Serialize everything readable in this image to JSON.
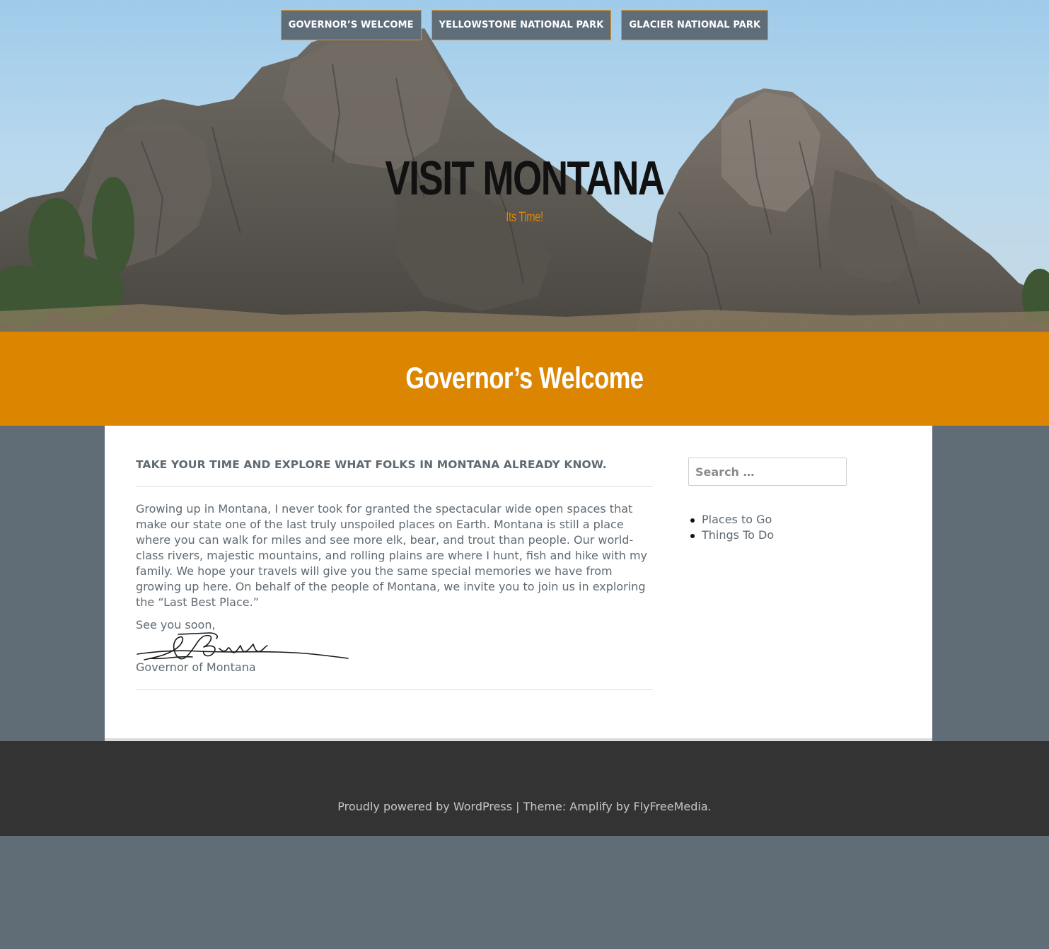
{
  "nav": {
    "items": [
      {
        "label": "GOVERNOR’S WELCOME"
      },
      {
        "label": "YELLOWSTONE NATIONAL PARK"
      },
      {
        "label": "GLACIER NATIONAL PARK"
      }
    ]
  },
  "site": {
    "title": "VISIT MONTANA",
    "tagline": "Its Time!"
  },
  "page": {
    "title": "Governor’s Welcome"
  },
  "entry": {
    "heading": "TAKE YOUR TIME AND EXPLORE WHAT FOLKS IN MONTANA ALREADY KNOW.",
    "body": "Growing up in Montana, I never took for granted the spectacular wide open spaces that make our state one of the last truly unspoiled places on Earth. Montana is still a place where you can walk for miles and see more elk, bear, and trout than people. Our world-class rivers, majestic mountains, and rolling plains are where I hunt, fish and hike with my family. We hope your travels will give you the same special memories we have from growing up here. On behalf of the people of Montana, we invite you to join us in exploring the “Last Best Place.”",
    "closing": "See you soon,",
    "sign_title": "Governor of Montana"
  },
  "sidebar": {
    "search_placeholder": "Search …",
    "links": [
      {
        "label": "Places to Go"
      },
      {
        "label": "Things To Do"
      }
    ]
  },
  "footer": {
    "powered_prefix": "Proudly powered by ",
    "wordpress": "WordPress",
    "separator": " | ",
    "theme_prefix": "Theme: Amplify by ",
    "theme_author": "FlyFreeMedia",
    "suffix": "."
  },
  "colors": {
    "accent": "#dc8500",
    "nav_bg": "#5f6d79",
    "page_bg": "#606c76",
    "footer_bg": "#333333"
  }
}
